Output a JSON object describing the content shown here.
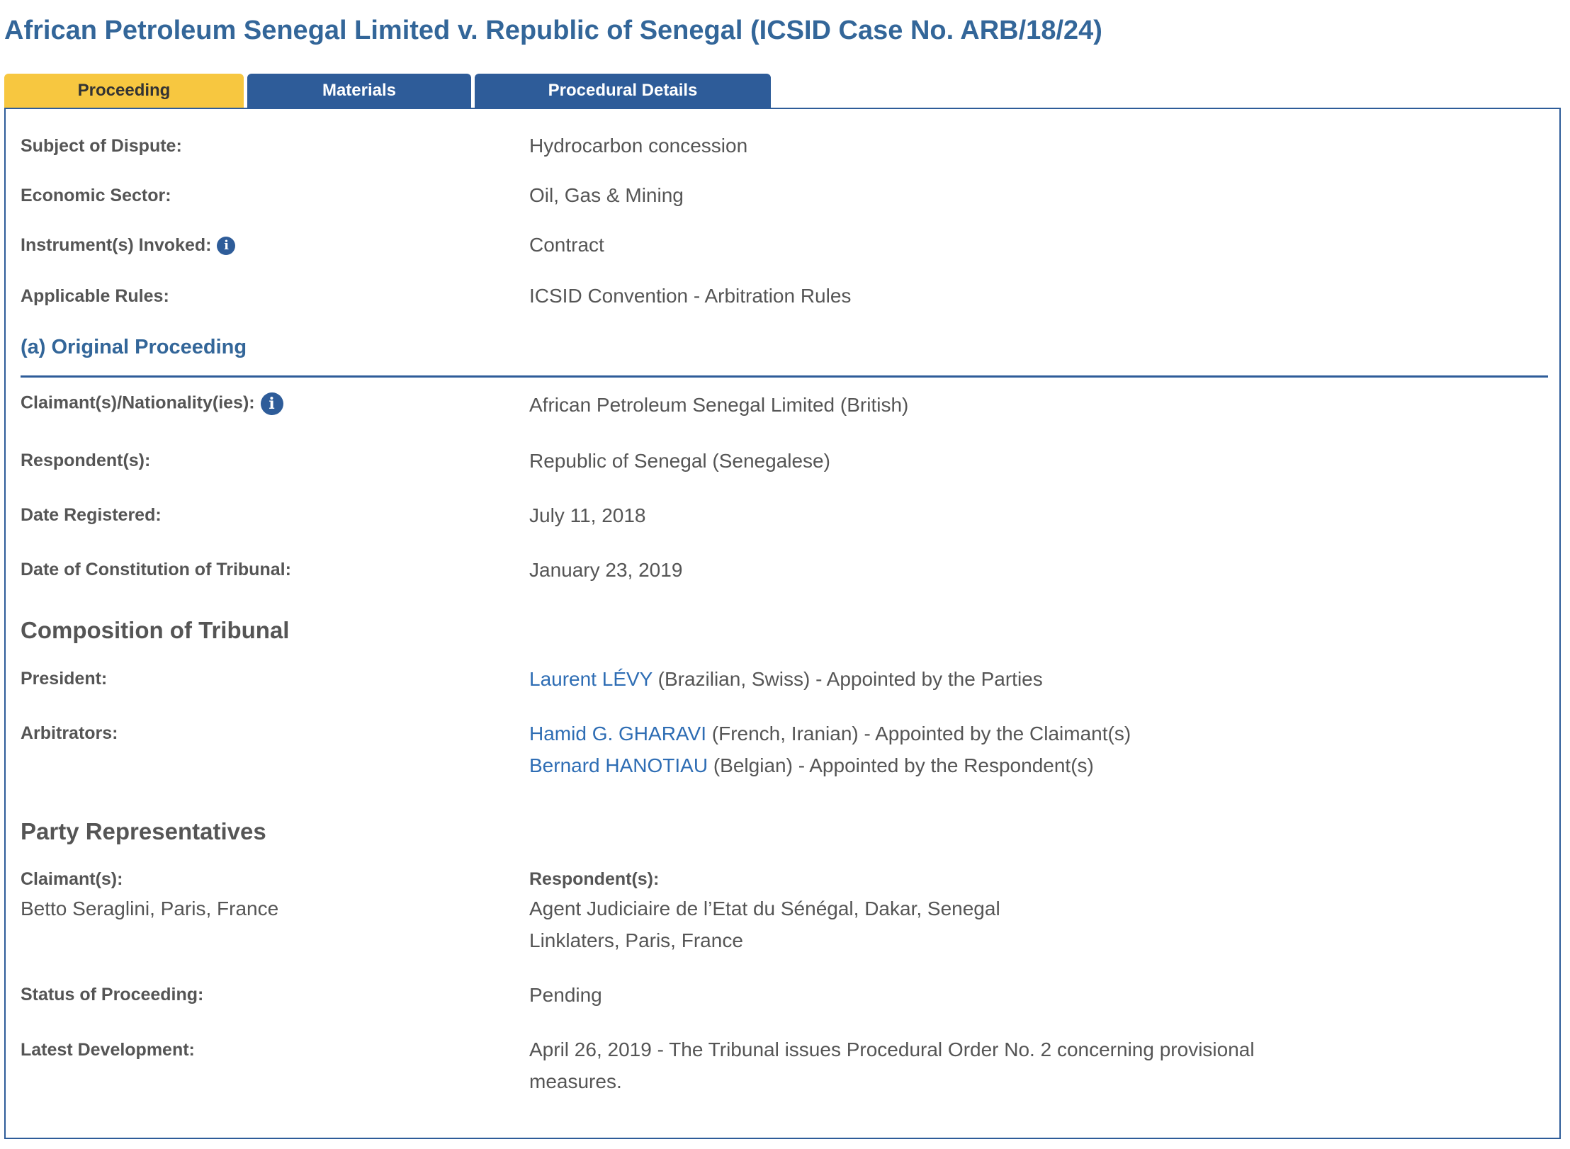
{
  "title": "African Petroleum Senegal Limited v. Republic of Senegal (ICSID Case No. ARB/18/24)",
  "tabs": [
    {
      "label": "Proceeding",
      "active": true
    },
    {
      "label": "Materials",
      "active": false
    },
    {
      "label": "Procedural Details",
      "active": false
    }
  ],
  "details": {
    "subject_label": "Subject of Dispute:",
    "subject_value": "Hydrocarbon concession",
    "sector_label": "Economic Sector:",
    "sector_value": "Oil, Gas & Mining",
    "instrument_label": "Instrument(s) Invoked:",
    "instrument_value": "Contract",
    "rules_label": "Applicable Rules:",
    "rules_value": "ICSID Convention - Arbitration Rules"
  },
  "original": {
    "heading": "(a) Original Proceeding",
    "claimant_label": "Claimant(s)/Nationality(ies):",
    "claimant_value": "African Petroleum Senegal Limited (British)",
    "respondent_label": "Respondent(s):",
    "respondent_value": "Republic of Senegal (Senegalese)",
    "registered_label": "Date Registered:",
    "registered_value": "July 11, 2018",
    "constitution_label": "Date of Constitution of Tribunal:",
    "constitution_value": "January 23, 2019"
  },
  "tribunal": {
    "heading": "Composition of Tribunal",
    "president_label": "President:",
    "president": {
      "name": "Laurent LÉVY",
      "detail": " (Brazilian, Swiss) - Appointed by the Parties"
    },
    "arbitrators_label": "Arbitrators:",
    "arbitrators": [
      {
        "name": "Hamid G. GHARAVI",
        "detail": " (French, Iranian) - Appointed by the Claimant(s)"
      },
      {
        "name": "Bernard HANOTIAU",
        "detail": " (Belgian) - Appointed by the Respondent(s)"
      }
    ]
  },
  "representatives": {
    "heading": "Party Representatives",
    "claimant_label": "Claimant(s):",
    "claimants": [
      "Betto Seraglini, Paris, France"
    ],
    "respondent_label": "Respondent(s):",
    "respondents": [
      "Agent Judiciaire de l’Etat du Sénégal, Dakar, Senegal",
      "Linklaters, Paris, France"
    ]
  },
  "status": {
    "status_label": "Status of Proceeding:",
    "status_value": "Pending",
    "latest_label": "Latest Development:",
    "latest_line1": "April 26, 2019 - The Tribunal issues Procedural Order No. 2 concerning provisional",
    "latest_line2": "measures."
  },
  "icons": {
    "info": "info-icon"
  }
}
